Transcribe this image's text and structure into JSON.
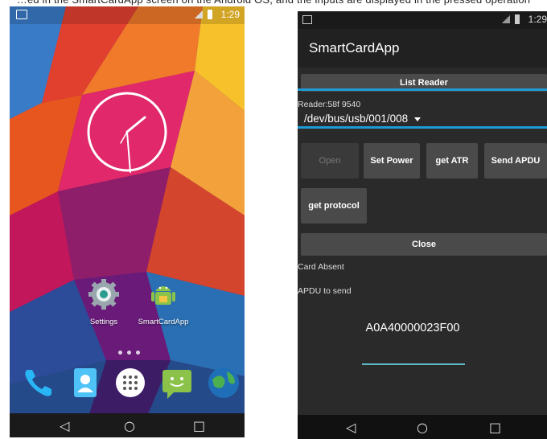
{
  "caption": "…ed in the SmartCardApp screen on the Android OS, and the inputs are displayed in the pressed operation",
  "home": {
    "status_time": "1:29",
    "apps": [
      {
        "label": "Settings",
        "icon": "settings-gear-icon"
      },
      {
        "label": "SmartCardApp",
        "icon": "android-icon"
      }
    ],
    "dock": [
      "phone-icon",
      "contacts-icon",
      "apps-grid-icon",
      "messaging-icon",
      "browser-globe-icon"
    ],
    "nav": [
      "back-icon",
      "home-icon",
      "recents-icon"
    ]
  },
  "app": {
    "status_time": "1:29",
    "title": "SmartCardApp",
    "list_reader_label": "List Reader",
    "reader_label": "Reader:58f 9540",
    "reader_selected": "/dev/bus/usb/001/008",
    "buttons": {
      "open": "Open",
      "set_power": "Set Power",
      "get_atr": "get ATR",
      "send_apdu": "Send APDU",
      "get_protocol": "get protocol",
      "close": "Close"
    },
    "card_status": "Card Absent",
    "apdu_label": "APDU to send",
    "apdu_value": "A0A40000023F00"
  },
  "colors": {
    "highlight": "#1e9ad6",
    "button_bg": "#4a4a4a",
    "app_bg": "#2a2a2a",
    "input_underline": "#5fb8c6"
  }
}
